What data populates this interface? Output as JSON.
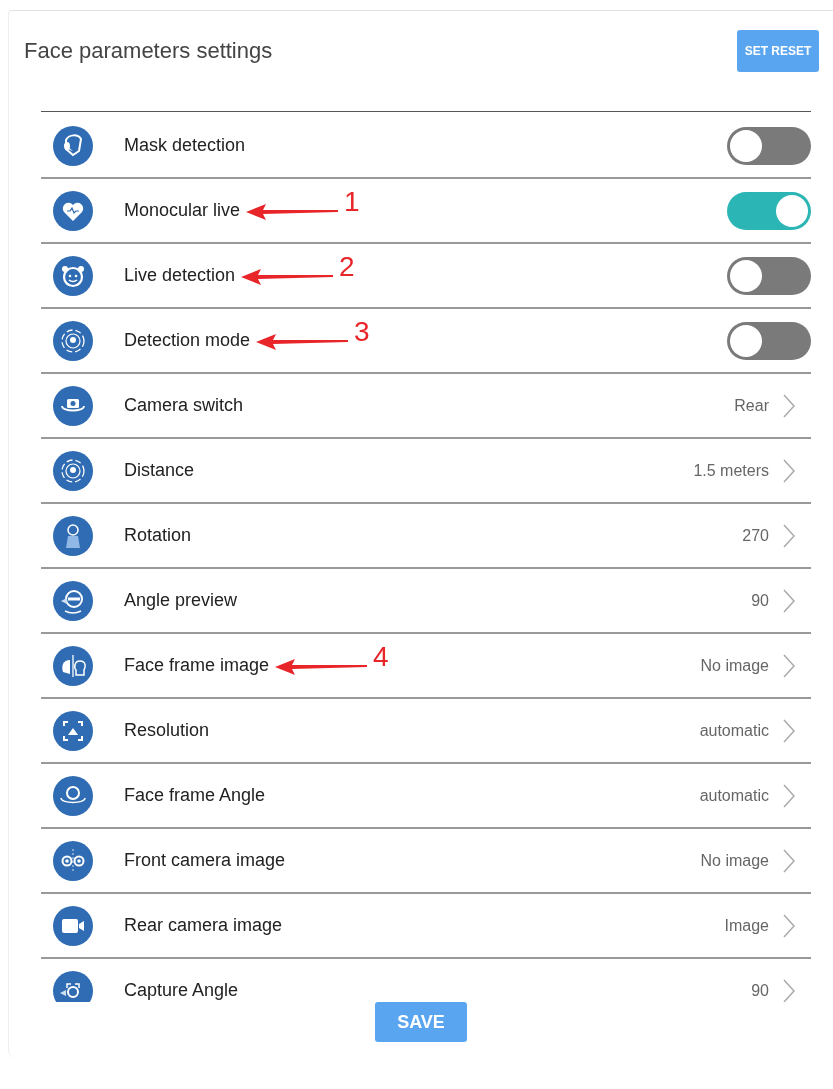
{
  "title": "Face parameters settings",
  "reset_button": "SET RESET",
  "settings": [
    {
      "label": "Mask detection",
      "kind": "toggle",
      "on": false
    },
    {
      "label": "Monocular live",
      "kind": "toggle",
      "on": true,
      "annotation": "1"
    },
    {
      "label": "Live detection",
      "kind": "toggle",
      "on": false,
      "annotation": "2"
    },
    {
      "label": "Detection mode",
      "kind": "toggle",
      "on": false,
      "annotation": "3"
    },
    {
      "label": "Camera switch",
      "kind": "value",
      "value": "Rear"
    },
    {
      "label": "Distance",
      "kind": "value",
      "value": "1.5 meters"
    },
    {
      "label": "Rotation",
      "kind": "value",
      "value": "270"
    },
    {
      "label": "Angle preview",
      "kind": "value",
      "value": "90"
    },
    {
      "label": "Face frame image",
      "kind": "value",
      "value": "No image",
      "annotation": "4"
    },
    {
      "label": "Resolution",
      "kind": "value",
      "value": "automatic"
    },
    {
      "label": "Face frame Angle",
      "kind": "value",
      "value": "automatic"
    },
    {
      "label": "Front camera image",
      "kind": "value",
      "value": "No image"
    },
    {
      "label": "Rear camera image",
      "kind": "value",
      "value": "Image"
    },
    {
      "label": "Capture Angle",
      "kind": "value",
      "value": "90"
    }
  ],
  "save_button": "SAVE"
}
